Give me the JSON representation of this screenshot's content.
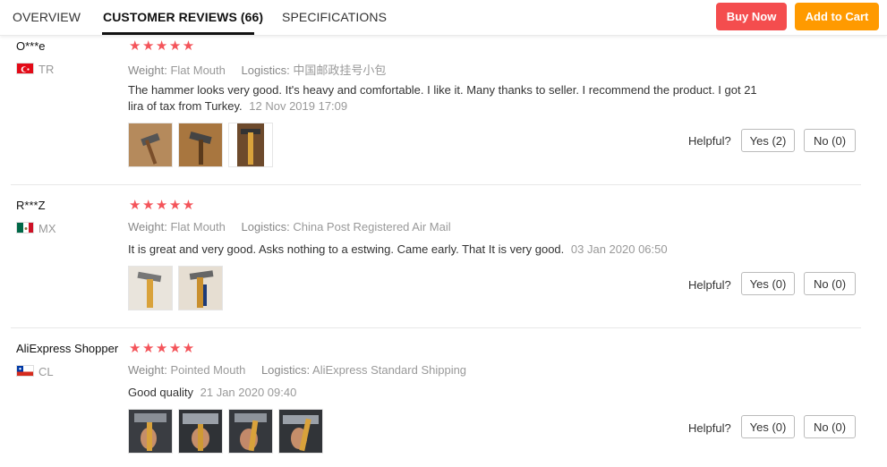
{
  "tabs": [
    {
      "label": "OVERVIEW"
    },
    {
      "label": "CUSTOMER REVIEWS (66)"
    },
    {
      "label": "SPECIFICATIONS"
    }
  ],
  "actions": {
    "buy_now": "Buy Now",
    "add_to_cart": "Add to Cart"
  },
  "colors": {
    "buy_now": "#f44d4e",
    "add_to_cart": "#ff9a00",
    "star": "#f4545a"
  },
  "rating_stars": "★★★★★",
  "labels": {
    "weight": "Weight:",
    "logistics": "Logistics:",
    "helpful": "Helpful?"
  },
  "reviews": [
    {
      "user": "O***e",
      "country": "TR",
      "flag_icon": "flag-turkey-icon",
      "stars": 5,
      "weight": "Flat Mouth",
      "logistics": "中国邮政挂号小包",
      "text": "The hammer looks very good. It's heavy and comfortable. I like it. Many thanks to seller. I recommend the product. I got 21 lira of tax from Turkey.",
      "date": "12 Nov 2019 17:09",
      "yes": "Yes (2)",
      "no": "No (0)"
    },
    {
      "user": "R***Z",
      "country": "MX",
      "flag_icon": "flag-mexico-icon",
      "stars": 5,
      "weight": "Flat Mouth",
      "logistics": "China Post Registered Air Mail",
      "text": "It is great and very good. Asks nothing to a estwing. Came early. That It is very good.",
      "date": "03 Jan 2020 06:50",
      "yes": "Yes (0)",
      "no": "No (0)"
    },
    {
      "user": "AliExpress Shopper",
      "country": "CL",
      "flag_icon": "flag-chile-icon",
      "stars": 5,
      "weight": "Pointed Mouth",
      "logistics": "AliExpress Standard Shipping",
      "text": "Good quality",
      "date": "21 Jan 2020 09:40",
      "yes": "Yes (0)",
      "no": "No (0)"
    }
  ]
}
